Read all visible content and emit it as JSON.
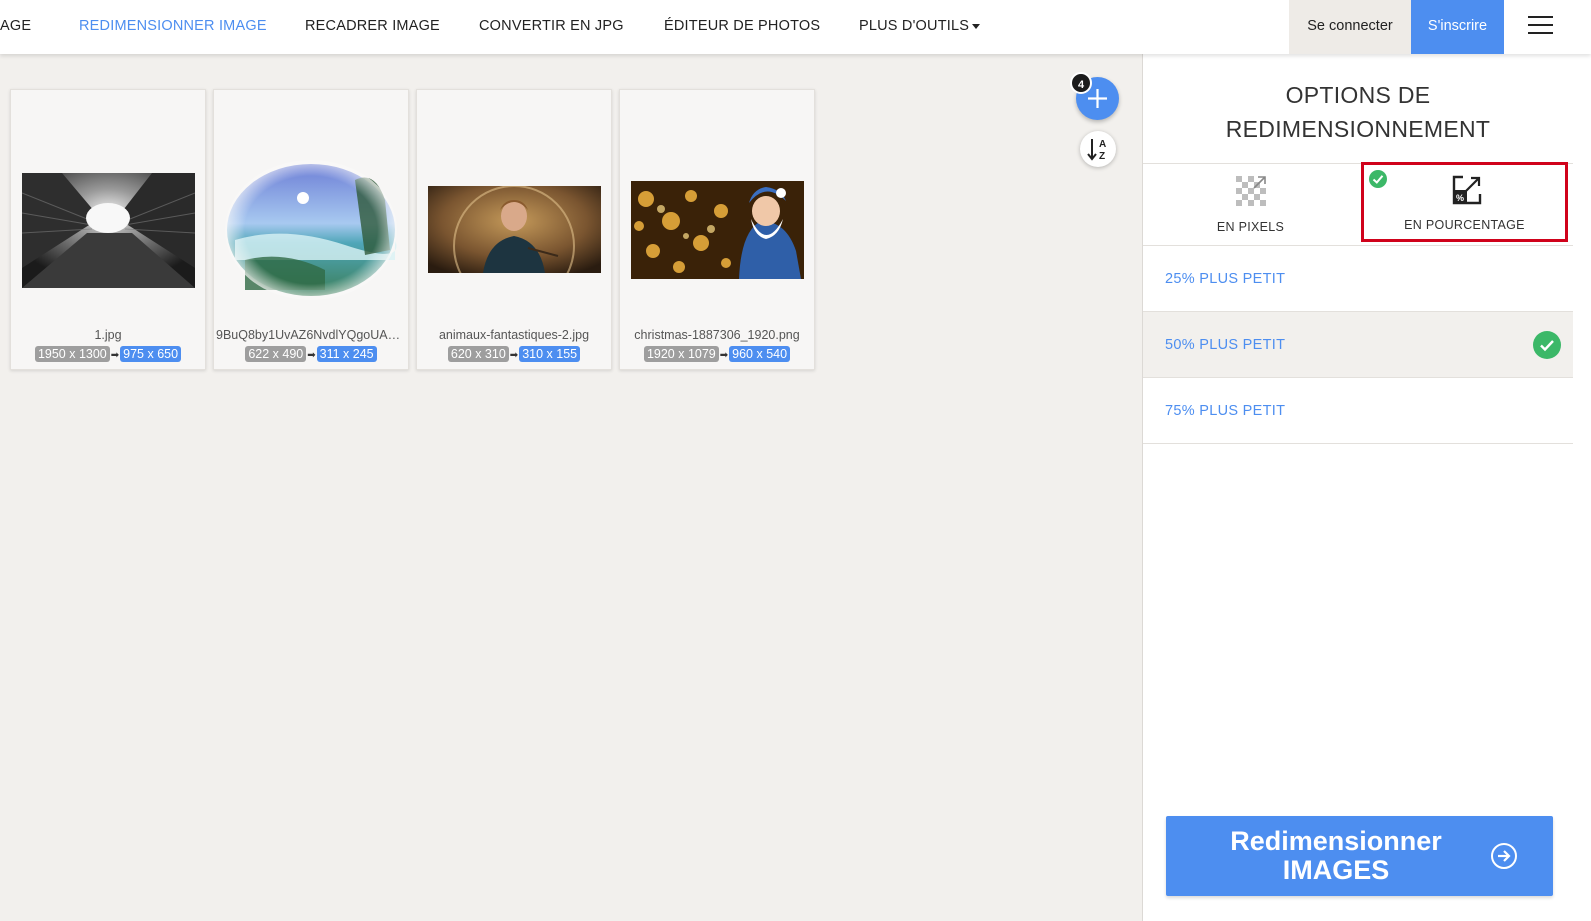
{
  "nav": {
    "items": [
      {
        "label": "AGE",
        "active": false
      },
      {
        "label": "REDIMENSIONNER IMAGE",
        "active": true
      },
      {
        "label": "RECADRER IMAGE",
        "active": false
      },
      {
        "label": "CONVERTIR EN JPG",
        "active": false
      },
      {
        "label": "ÉDITEUR DE PHOTOS",
        "active": false
      },
      {
        "label": "PLUS D'OUTILS",
        "active": false
      }
    ],
    "login_label": "Se connecter",
    "signup_label": "S'inscrire",
    "menu_icon": "hamburger-icon"
  },
  "images": [
    {
      "filename": "1.jpg",
      "original_size": "1950 x 1300",
      "new_size": "975 x 650",
      "arrow": "➡"
    },
    {
      "filename": "9BuQ8by1UvAZ6NvdlYQgoUAO...",
      "original_size": "622 x 490",
      "new_size": "311 x 245",
      "arrow": "➡"
    },
    {
      "filename": "animaux-fantastiques-2.jpg",
      "original_size": "620 x 310",
      "new_size": "310 x 155",
      "arrow": "➡"
    },
    {
      "filename": "christmas-1887306_1920.png",
      "original_size": "1920 x 1079",
      "new_size": "960 x 540",
      "arrow": "➡"
    }
  ],
  "toolbar": {
    "add_count": "4",
    "add_icon": "plus-icon",
    "sort_icon": "sort-alpha-icon"
  },
  "panel": {
    "title_line1": "OPTIONS DE",
    "title_line2": "REDIMENSIONNEMENT",
    "modes": [
      {
        "label": "EN PIXELS",
        "icon": "pixel-resize-icon",
        "selected": false
      },
      {
        "label": "EN POURCENTAGE",
        "icon": "percent-resize-icon",
        "selected": true
      }
    ],
    "options": [
      {
        "label": "25% PLUS PETIT",
        "selected": false
      },
      {
        "label": "50% PLUS PETIT",
        "selected": true
      },
      {
        "label": "75% PLUS PETIT",
        "selected": false
      }
    ],
    "submit_line1": "Redimensionner",
    "submit_line2": "IMAGES",
    "submit_icon": "arrow-circle-right-icon"
  },
  "colors": {
    "accent": "#4d8ef0",
    "success": "#3cb868",
    "highlight": "#d0021b",
    "background": "#f2f0ed"
  }
}
